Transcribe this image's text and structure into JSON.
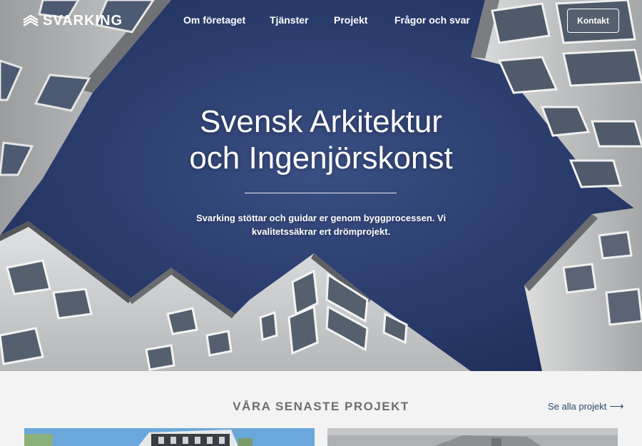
{
  "header": {
    "logo_text": "SVARKING",
    "logo_icon": "stacked-chevrons-logo-icon",
    "nav": [
      {
        "label": "Om företaget"
      },
      {
        "label": "Tjänster"
      },
      {
        "label": "Projekt"
      },
      {
        "label": "Frågor och svar"
      }
    ],
    "cta_label": "Kontakt"
  },
  "hero": {
    "title_line1": "Svensk Arkitektur",
    "title_line2": "och Ingenjörskonst",
    "subtitle_line1": "Svarking stöttar och guidar er genom byggprocessen. Vi",
    "subtitle_line2": "kvalitetssäkrar ert drömprojekt.",
    "background": "upward view of white apartment buildings against a deep blue sky"
  },
  "projects": {
    "section_title": "VÅRA SENASTE PROJEKT",
    "see_all_label": "Se alla projekt",
    "see_all_icon": "arrow-right-icon"
  },
  "colors": {
    "sky": "#2c3e6e",
    "link": "#2a4a6e",
    "section_bg": "#f3f3f3",
    "section_title": "#6e6e6e"
  }
}
